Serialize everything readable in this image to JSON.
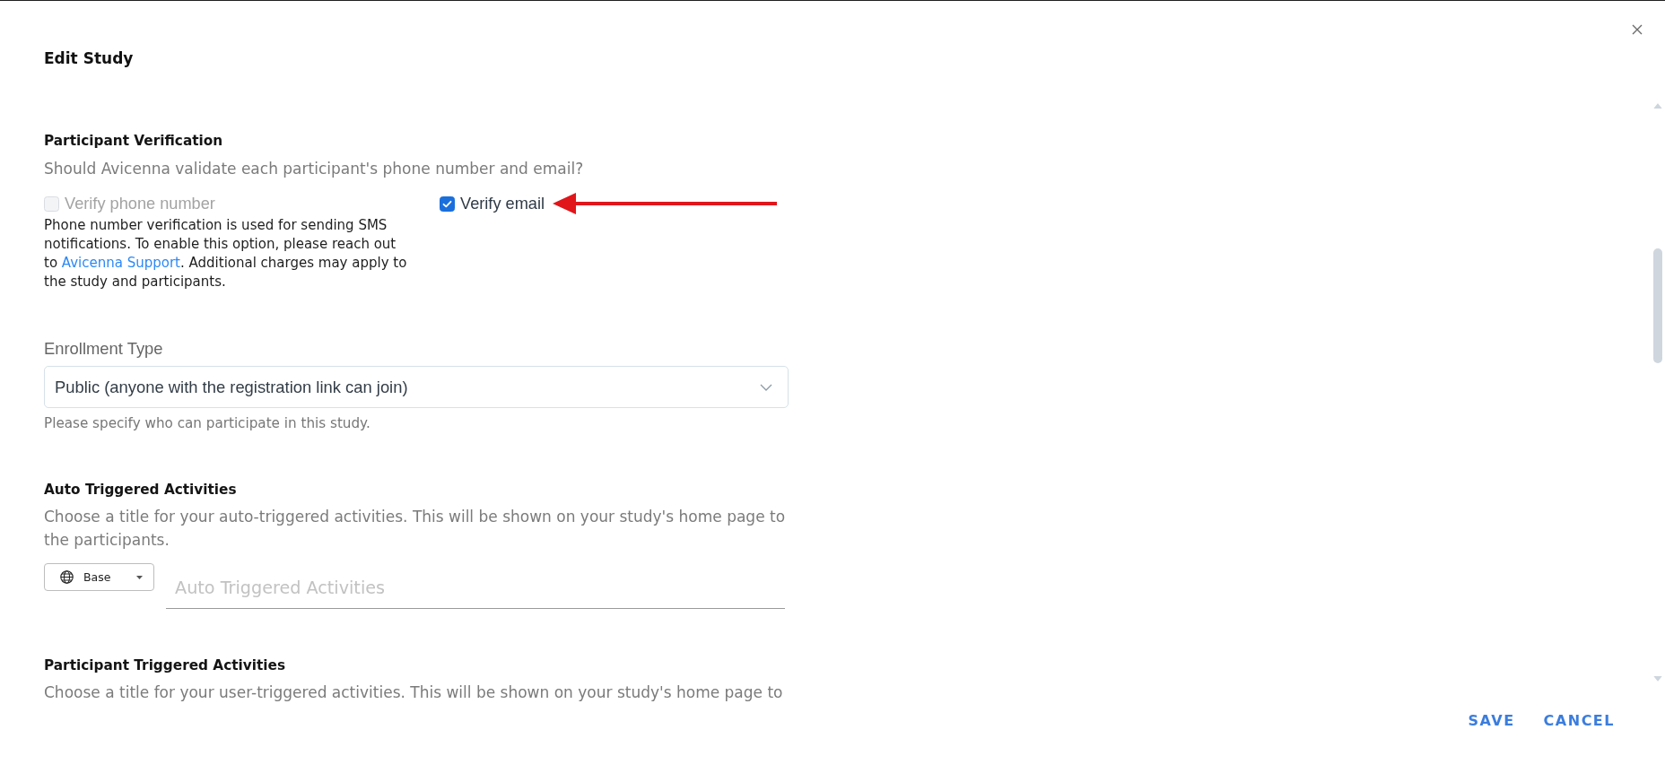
{
  "dialog": {
    "title": "Edit Study"
  },
  "sections": [
    {
      "kind": "checkbox_group",
      "heading": "Participant Verification",
      "description": "Should Avicenna validate each participant's phone number and email?",
      "options": [
        {
          "label": "Verify phone number",
          "checked": false,
          "disabled": true,
          "help": [
            {
              "kind": "text",
              "text": "Phone number verification is used for sending SMS notifications. To enable this option, please reach out to "
            },
            {
              "kind": "link",
              "text": "Avicenna Support"
            },
            {
              "kind": "text",
              "text": ". Additional charges may apply to the study and participants."
            }
          ]
        },
        {
          "label": "Verify email",
          "checked": true,
          "disabled": false,
          "annotated": true
        }
      ]
    },
    {
      "kind": "select",
      "label": "Enrollment Type",
      "value": "Public (anyone with the registration link can join)",
      "helper": "Please specify who can participate in this study."
    },
    {
      "kind": "title_input",
      "heading": "Auto Triggered Activities",
      "description": "Choose a title for your auto-triggered activities. This will be shown on your study's home page to the participants.",
      "language": "Base",
      "placeholder": "Auto Triggered Activities"
    },
    {
      "kind": "title_input",
      "heading": "Participant Triggered Activities",
      "description": "Choose a title for your user-triggered activities. This will be shown on your study's home page to"
    }
  ],
  "footer": {
    "buttons": [
      {
        "label": "SAVE"
      },
      {
        "label": "CANCEL"
      }
    ]
  }
}
